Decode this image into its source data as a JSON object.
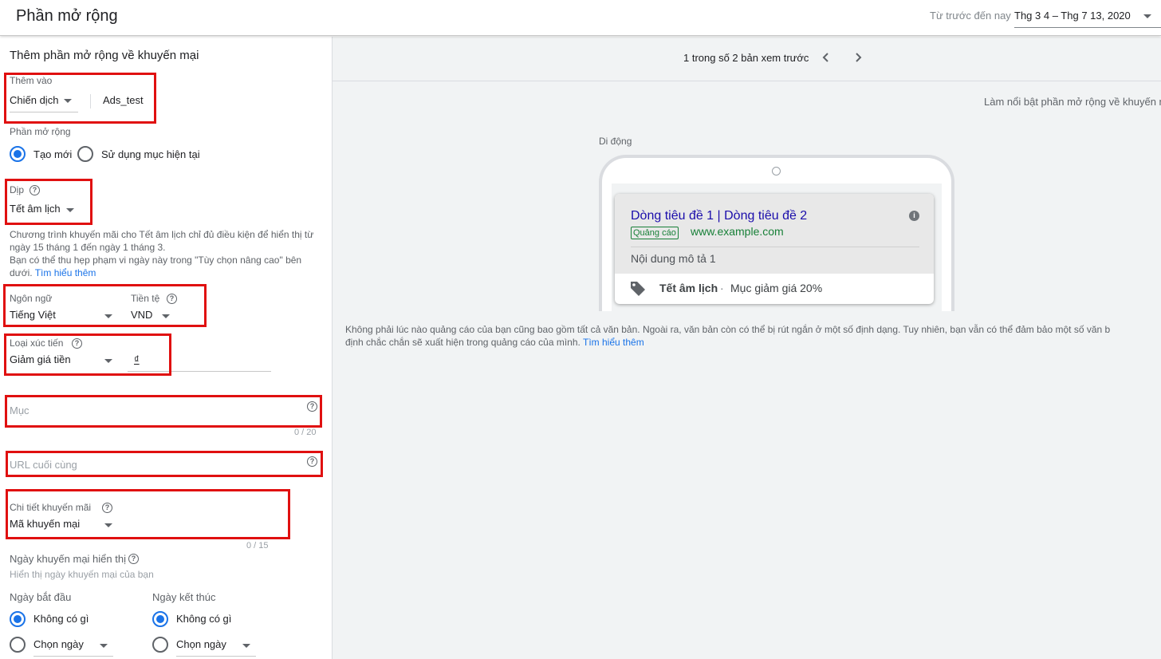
{
  "header": {
    "title": "Phần mở rộng",
    "date_label": "Từ trước đến nay",
    "date_range": "Thg 3 4 – Thg 7 13, 2020"
  },
  "form": {
    "section_title": "Thêm phần mở rộng về khuyến mại",
    "add_to": {
      "label": "Thêm vào",
      "level": "Chiến dịch",
      "campaign": "Ads_test"
    },
    "extension": {
      "label": "Phần mở rộng",
      "option_new": "Tạo mới",
      "option_existing": "Sử dụng mục hiện tại"
    },
    "occasion": {
      "label": "Dịp",
      "value": "Tết âm lịch",
      "info_line1": "Chương trình khuyến mãi cho Tết âm lịch chỉ đủ điều kiện để hiển thị từ",
      "info_line2": "ngày 15 tháng 1 đến ngày 1 tháng 3.",
      "info_line3": "Bạn có thể thu hẹp phạm vi ngày này trong \"Tùy chọn nâng cao\" bên",
      "info_line4": "dưới.",
      "learn_more": "Tìm hiểu thêm"
    },
    "language": {
      "label": "Ngôn ngữ",
      "value": "Tiếng Việt"
    },
    "currency": {
      "label": "Tiền tệ",
      "value": "VND"
    },
    "promotion_type": {
      "label": "Loại xúc tiến",
      "value": "Giảm giá tiền",
      "currency_symbol": "₫"
    },
    "item": {
      "placeholder": "Mục",
      "counter": "0 / 20"
    },
    "final_url": {
      "placeholder": "URL cuối cùng"
    },
    "promotion_details": {
      "label": "Chi tiết khuyến mãi",
      "value": "Mã khuyến mại",
      "counter": "0 / 15"
    },
    "display_dates": {
      "label": "Ngày khuyến mại hiển thị",
      "hint": "Hiển thị ngày khuyến mại của bạn"
    },
    "start_date": {
      "label": "Ngày bắt đầu",
      "option_none": "Không có gì",
      "option_pick": "Chọn ngày"
    },
    "end_date": {
      "label": "Ngày kết thúc",
      "option_none": "Không có gì",
      "option_pick": "Chọn ngày"
    }
  },
  "preview": {
    "counter": "1 trong số 2 bản xem trước",
    "highlight_text": "Làm nổi bật phần mở rộng về khuyến m",
    "device_label": "Di động",
    "ad": {
      "headline": "Dòng tiêu đề 1 | Dòng tiêu đề 2",
      "badge": "Quảng cáo",
      "url": "www.example.com",
      "description": "Nội dung mô tả 1",
      "promo_occasion": "Tết âm lịch",
      "separator": "·",
      "promo_text": "Mục giảm giá 20%"
    },
    "disclaimer_line1": "Không phải lúc nào quảng cáo của bạn cũng bao gồm tất cả văn bản. Ngoài ra, văn bản còn có thể bị rút ngắn ở một số định dạng. Tuy nhiên, bạn vẫn có thể đảm bảo một số văn b",
    "disclaimer_line2": "định chắc chắn sẽ xuất hiện trong quảng cáo của mình.",
    "learn_more": "Tìm hiểu thêm"
  },
  "colors": {
    "accent": "#1a73e8",
    "annotation_red": "#e01010",
    "ad_badge_green": "#188038",
    "ad_headline": "#1a0dab"
  }
}
